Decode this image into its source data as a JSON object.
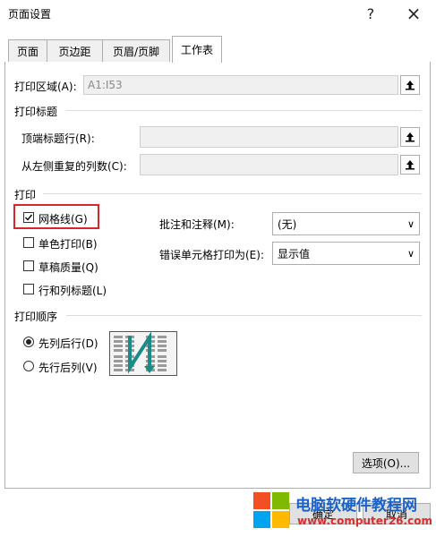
{
  "window": {
    "title": "页面设置",
    "help": "?",
    "close": "×"
  },
  "tabs": [
    "页面",
    "页边距",
    "页眉/页脚",
    "工作表"
  ],
  "print_area": {
    "label": "打印区域(A):",
    "value": "A1:I53"
  },
  "print_titles": {
    "section": "打印标题",
    "rows_label": "顶端标题行(R):",
    "cols_label": "从左侧重复的列数(C):"
  },
  "print": {
    "section": "打印",
    "gridlines": {
      "label": "网格线(G)",
      "checked": true
    },
    "mono": {
      "label": "单色打印(B)",
      "checked": false
    },
    "draft": {
      "label": "草稿质量(Q)",
      "checked": false
    },
    "headings": {
      "label": "行和列标题(L)",
      "checked": false
    },
    "comments_label": "批注和注释(M):",
    "comments_value": "(无)",
    "errors_label": "错误单元格打印为(E):",
    "errors_value": "显示值"
  },
  "order": {
    "section": "打印顺序",
    "down_then_over": "先列后行(D)",
    "over_then_down": "先行后列(V)",
    "selected": "down_then_over"
  },
  "buttons": {
    "options": "选项(O)...",
    "ok": "确定",
    "cancel": "取消"
  },
  "watermark": {
    "title": "电脑软硬件教程网",
    "url": "www.computer26.com"
  },
  "colors": {
    "highlight": "#d9262c",
    "arrow": "#1a8c88"
  }
}
